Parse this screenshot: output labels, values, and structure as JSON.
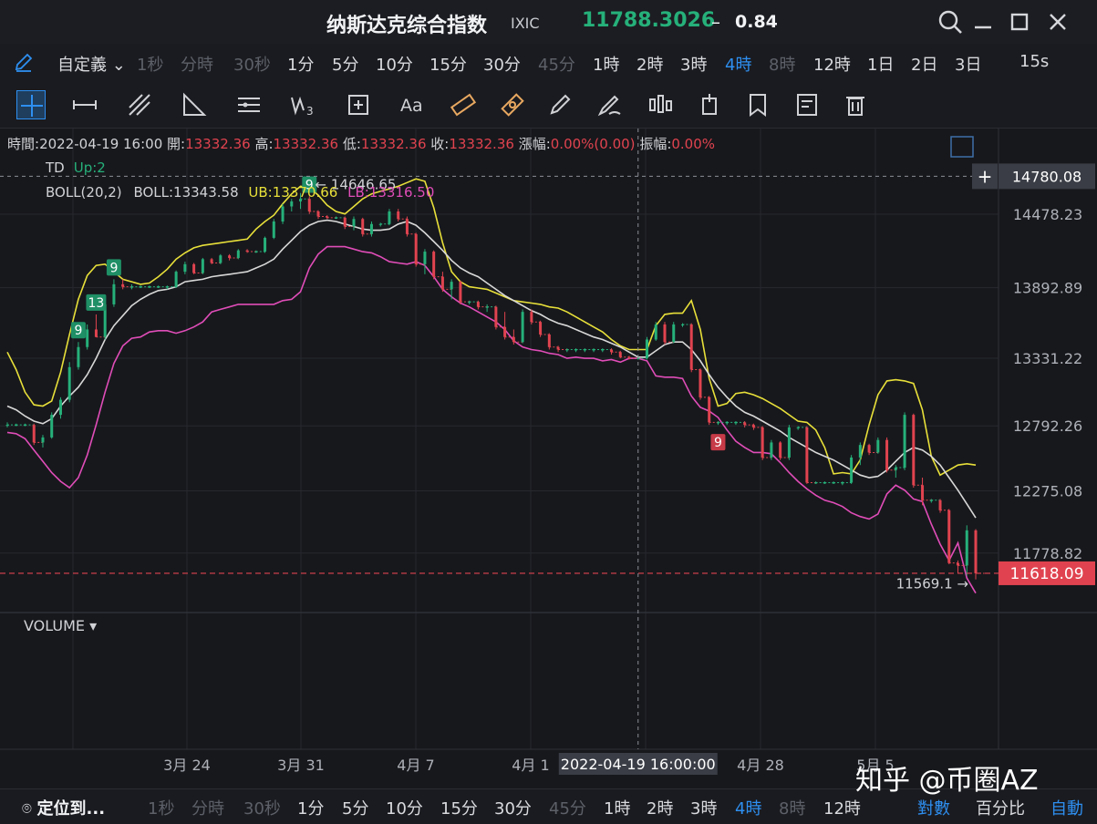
{
  "title": {
    "name": "纳斯达克综合指数",
    "code": "IXIC",
    "price": "11788.3026",
    "dash": "–",
    "change": "0.84"
  },
  "intervals": {
    "selector_label": "自定義",
    "items": [
      {
        "label": "1秒",
        "state": "dim"
      },
      {
        "label": "分時",
        "state": "dim"
      },
      {
        "label": "30秒",
        "state": "dim"
      },
      {
        "label": "1分",
        "state": "normal"
      },
      {
        "label": "5分",
        "state": "normal"
      },
      {
        "label": "10分",
        "state": "normal"
      },
      {
        "label": "15分",
        "state": "normal"
      },
      {
        "label": "30分",
        "state": "normal"
      },
      {
        "label": "45分",
        "state": "dim"
      },
      {
        "label": "1時",
        "state": "normal"
      },
      {
        "label": "2時",
        "state": "normal"
      },
      {
        "label": "3時",
        "state": "normal"
      },
      {
        "label": "4時",
        "state": "active"
      },
      {
        "label": "8時",
        "state": "dim"
      },
      {
        "label": "12時",
        "state": "normal"
      },
      {
        "label": "1日",
        "state": "normal"
      },
      {
        "label": "2日",
        "state": "normal"
      },
      {
        "label": "3日",
        "state": "normal"
      }
    ],
    "refresh": "15s"
  },
  "tools": [
    "crosshair-tool",
    "horizontal-line-tool",
    "trend-line-tool",
    "angle-tool",
    "parallel-lines-tool",
    "wave-tool",
    "measure-box-tool",
    "text-tool",
    "ruler-tool",
    "price-range-tool",
    "pen-tool",
    "brush-tool",
    "candle-tool",
    "position-tool",
    "bookmark-tool",
    "note-tool",
    "delete-tool"
  ],
  "info": {
    "time_label": "時間:",
    "time": "2022-04-19 16:00",
    "open_label": "開:",
    "open": "13332.36",
    "high_label": "高:",
    "high": "13332.36",
    "low_label": "低:",
    "low": "13332.36",
    "close_label": "收:",
    "close": "13332.36",
    "change_label": "漲幅:",
    "change": "0.00%(0.00)",
    "amp_label": "振幅:",
    "amp": "0.00%"
  },
  "indicators": {
    "td": "TD",
    "td_up": "Up:2",
    "boll": "BOLL(20,2)",
    "boll_mid": "BOLL:13343.58",
    "boll_ub": "UB:13370.66",
    "boll_lb": "LB:13316.50"
  },
  "volume_label": "VOLUME",
  "bottom": {
    "locate": "定位到...",
    "items": [
      {
        "label": "1秒",
        "state": "dim"
      },
      {
        "label": "分時",
        "state": "dim"
      },
      {
        "label": "30秒",
        "state": "dim"
      },
      {
        "label": "1分",
        "state": "normal"
      },
      {
        "label": "5分",
        "state": "normal"
      },
      {
        "label": "10分",
        "state": "normal"
      },
      {
        "label": "15分",
        "state": "normal"
      },
      {
        "label": "30分",
        "state": "normal"
      },
      {
        "label": "45分",
        "state": "dim"
      },
      {
        "label": "1時",
        "state": "normal"
      },
      {
        "label": "2時",
        "state": "normal"
      },
      {
        "label": "3時",
        "state": "normal"
      },
      {
        "label": "4時",
        "state": "active"
      },
      {
        "label": "8時",
        "state": "dim"
      },
      {
        "label": "12時",
        "state": "normal"
      }
    ],
    "log_label": "對數",
    "percent_label": "百分比",
    "auto_label": "自動"
  },
  "watermark": "知乎 @币圈AZ",
  "colors": {
    "up": "#26b07a",
    "down": "#e0434f",
    "ub": "#e8e03a",
    "lb": "#e04db8",
    "mid": "#d8d8d8",
    "accent": "#2e8ff0"
  },
  "chart_data": {
    "type": "candlestick",
    "x_ticks": [
      "3月 24",
      "3月 31",
      "4月 7",
      "4月 1",
      "4月 28",
      "5月 5"
    ],
    "y_ticks": [
      14478.23,
      13892.89,
      13331.22,
      12792.26,
      12275.08,
      11778.82
    ],
    "ylim": [
      11320,
      14950
    ],
    "crosshair": {
      "price": "14780.08",
      "date": "2022-04-19 16:00:00",
      "index": 71
    },
    "last_price": "11618.09",
    "max_marker": "14646.65",
    "min_marker": "11569.1",
    "td_marks": [
      {
        "index": 8,
        "label": "9",
        "dir": "up"
      },
      {
        "index": 12,
        "label": "9",
        "dir": "up"
      },
      {
        "index": 10,
        "label": "13",
        "dir": "up"
      },
      {
        "index": 34,
        "label": "9",
        "dir": "up"
      },
      {
        "index": 80,
        "label": "9",
        "dir": "down"
      }
    ],
    "mid": [
      12950,
      12920,
      12870,
      12830,
      12810,
      12850,
      12950,
      13030,
      13100,
      13200,
      13330,
      13480,
      13590,
      13670,
      13750,
      13800,
      13840,
      13870,
      13880,
      13900,
      13940,
      13950,
      13960,
      13980,
      13990,
      14000,
      14010,
      14020,
      14050,
      14080,
      14120,
      14200,
      14270,
      14340,
      14390,
      14420,
      14430,
      14420,
      14400,
      14380,
      14360,
      14350,
      14350,
      14360,
      14400,
      14420,
      14390,
      14330,
      14260,
      14190,
      14110,
      14050,
      14010,
      13980,
      13930,
      13880,
      13830,
      13790,
      13750,
      13710,
      13680,
      13640,
      13610,
      13590,
      13560,
      13530,
      13500,
      13480,
      13450,
      13420,
      13380,
      13340,
      13340,
      13390,
      13440,
      13460,
      13460,
      13400,
      13310,
      13200,
      13100,
      13020,
      12950,
      12900,
      12870,
      12830,
      12790,
      12750,
      12700,
      12660,
      12620,
      12580,
      12550,
      12520,
      12480,
      12440,
      12400,
      12380,
      12390,
      12440,
      12510,
      12580,
      12620,
      12600,
      12550,
      12480,
      12380,
      12280,
      12170,
      12060
    ],
    "ub": [
      13380,
      13240,
      13060,
      12960,
      12950,
      12990,
      13220,
      13520,
      13800,
      13990,
      14070,
      14080,
      14020,
      13960,
      13940,
      13920,
      13930,
      13980,
      14040,
      14120,
      14170,
      14210,
      14230,
      14240,
      14250,
      14260,
      14270,
      14280,
      14360,
      14420,
      14470,
      14560,
      14640,
      14700,
      14690,
      14630,
      14550,
      14500,
      14480,
      14540,
      14600,
      14640,
      14660,
      14680,
      14700,
      14730,
      14760,
      14740,
      14530,
      14250,
      14020,
      13940,
      13900,
      13890,
      13880,
      13850,
      13820,
      13790,
      13780,
      13770,
      13760,
      13740,
      13730,
      13700,
      13660,
      13620,
      13580,
      13540,
      13480,
      13430,
      13400,
      13400,
      13400,
      13590,
      13680,
      13690,
      13690,
      13790,
      13560,
      13170,
      12950,
      12970,
      13050,
      13060,
      13040,
      13010,
      12970,
      12930,
      12880,
      12830,
      12820,
      12760,
      12620,
      12410,
      12420,
      12410,
      12520,
      12800,
      13040,
      13150,
      13160,
      13150,
      13130,
      12920,
      12550,
      12400,
      12440,
      12480,
      12490,
      12480
    ],
    "lb": [
      12740,
      12730,
      12690,
      12600,
      12510,
      12420,
      12350,
      12300,
      12380,
      12560,
      12800,
      13060,
      13290,
      13430,
      13490,
      13500,
      13540,
      13550,
      13550,
      13530,
      13550,
      13580,
      13620,
      13700,
      13720,
      13740,
      13760,
      13760,
      13760,
      13760,
      13760,
      13790,
      13800,
      13860,
      14050,
      14160,
      14220,
      14220,
      14220,
      14200,
      14180,
      14170,
      14140,
      14100,
      14090,
      14080,
      14100,
      14070,
      13980,
      13880,
      13820,
      13770,
      13740,
      13700,
      13660,
      13620,
      13560,
      13470,
      13420,
      13400,
      13390,
      13370,
      13360,
      13330,
      13340,
      13330,
      13330,
      13310,
      13320,
      13300,
      13330,
      13330,
      13310,
      13190,
      13180,
      13180,
      13170,
      13030,
      12940,
      12910,
      12860,
      12760,
      12670,
      12620,
      12580,
      12580,
      12570,
      12500,
      12420,
      12350,
      12290,
      12240,
      12200,
      12180,
      12150,
      12100,
      12070,
      12050,
      12090,
      12250,
      12320,
      12280,
      12210,
      12190,
      12010,
      11850,
      11720,
      11860,
      11580,
      11460
    ],
    "candles": [
      [
        12800,
        12820,
        12780,
        12800
      ],
      [
        12800,
        12810,
        12790,
        12800
      ],
      [
        12800,
        12810,
        12790,
        12800
      ],
      [
        12800,
        12810,
        12640,
        12660
      ],
      [
        12660,
        12720,
        12620,
        12700
      ],
      [
        12700,
        12900,
        12690,
        12880
      ],
      [
        12880,
        13020,
        12850,
        13000
      ],
      [
        13000,
        13300,
        12980,
        13260
      ],
      [
        13260,
        13460,
        13240,
        13420
      ],
      [
        13420,
        13600,
        13400,
        13560
      ],
      [
        13560,
        13680,
        13500,
        13500
      ],
      [
        13500,
        13820,
        13480,
        13760
      ],
      [
        13760,
        13960,
        13740,
        13920
      ],
      [
        13920,
        13960,
        13880,
        13900
      ],
      [
        13900,
        13920,
        13880,
        13900
      ],
      [
        13900,
        13910,
        13890,
        13900
      ],
      [
        13900,
        13910,
        13890,
        13900
      ],
      [
        13900,
        13910,
        13890,
        13900
      ],
      [
        13900,
        13910,
        13880,
        13900
      ],
      [
        13900,
        14030,
        13890,
        14020
      ],
      [
        14020,
        14100,
        14000,
        14080
      ],
      [
        14080,
        14090,
        14000,
        14010
      ],
      [
        14010,
        14130,
        14000,
        14120
      ],
      [
        14120,
        14130,
        14080,
        14090
      ],
      [
        14090,
        14160,
        14080,
        14150
      ],
      [
        14150,
        14160,
        14110,
        14130
      ],
      [
        14130,
        14200,
        14120,
        14190
      ],
      [
        14190,
        14200,
        14170,
        14180
      ],
      [
        14180,
        14190,
        14170,
        14180
      ],
      [
        14180,
        14300,
        14170,
        14290
      ],
      [
        14290,
        14440,
        14280,
        14420
      ],
      [
        14420,
        14560,
        14400,
        14540
      ],
      [
        14540,
        14600,
        14500,
        14580
      ],
      [
        14580,
        14647,
        14520,
        14600
      ],
      [
        14600,
        14620,
        14480,
        14500
      ],
      [
        14500,
        14510,
        14440,
        14460
      ],
      [
        14460,
        14470,
        14440,
        14450
      ],
      [
        14450,
        14460,
        14440,
        14450
      ],
      [
        14450,
        14460,
        14360,
        14380
      ],
      [
        14380,
        14460,
        14350,
        14440
      ],
      [
        14440,
        14450,
        14300,
        14320
      ],
      [
        14320,
        14420,
        14300,
        14400
      ],
      [
        14400,
        14410,
        14380,
        14400
      ],
      [
        14400,
        14520,
        14390,
        14500
      ],
      [
        14500,
        14520,
        14420,
        14440
      ],
      [
        14440,
        14460,
        14300,
        14320
      ],
      [
        14320,
        14330,
        14060,
        14080
      ],
      [
        14080,
        14200,
        14000,
        14180
      ],
      [
        14180,
        14190,
        13960,
        13980
      ],
      [
        13980,
        14020,
        13860,
        13880
      ],
      [
        13880,
        13960,
        13800,
        13940
      ],
      [
        13940,
        13950,
        13760,
        13780
      ],
      [
        13780,
        13790,
        13760,
        13780
      ],
      [
        13780,
        13790,
        13720,
        13740
      ],
      [
        13740,
        13760,
        13700,
        13740
      ],
      [
        13740,
        13750,
        13560,
        13580
      ],
      [
        13580,
        13700,
        13480,
        13500
      ],
      [
        13500,
        13560,
        13440,
        13460
      ],
      [
        13460,
        13720,
        13450,
        13700
      ],
      [
        13700,
        13720,
        13600,
        13620
      ],
      [
        13620,
        13630,
        13500,
        13520
      ],
      [
        13520,
        13530,
        13400,
        13420
      ],
      [
        13420,
        13430,
        13380,
        13400
      ],
      [
        13400,
        13410,
        13380,
        13400
      ],
      [
        13400,
        13410,
        13380,
        13400
      ],
      [
        13400,
        13410,
        13380,
        13400
      ],
      [
        13400,
        13410,
        13380,
        13400
      ],
      [
        13400,
        13410,
        13380,
        13400
      ],
      [
        13400,
        13410,
        13360,
        13380
      ],
      [
        13380,
        13390,
        13330,
        13340
      ],
      [
        13340,
        13350,
        13320,
        13332
      ],
      [
        13332,
        13340,
        13320,
        13332
      ],
      [
        13332,
        13500,
        13320,
        13480
      ],
      [
        13480,
        13620,
        13470,
        13600
      ],
      [
        13600,
        13620,
        13440,
        13460
      ],
      [
        13460,
        13620,
        13450,
        13600
      ],
      [
        13600,
        13610,
        13580,
        13600
      ],
      [
        13600,
        13610,
        13220,
        13240
      ],
      [
        13240,
        13250,
        13000,
        13020
      ],
      [
        13020,
        13030,
        12800,
        12820
      ],
      [
        12820,
        12830,
        12800,
        12820
      ],
      [
        12820,
        12830,
        12800,
        12820
      ],
      [
        12820,
        12830,
        12800,
        12820
      ],
      [
        12820,
        12830,
        12780,
        12800
      ],
      [
        12800,
        12810,
        12760,
        12780
      ],
      [
        12780,
        12790,
        12520,
        12540
      ],
      [
        12540,
        12680,
        12520,
        12660
      ],
      [
        12660,
        12670,
        12520,
        12540
      ],
      [
        12540,
        12800,
        12520,
        12780
      ],
      [
        12780,
        12790,
        12760,
        12780
      ],
      [
        12780,
        12790,
        12330,
        12340
      ],
      [
        12340,
        12350,
        12330,
        12340
      ],
      [
        12340,
        12350,
        12330,
        12340
      ],
      [
        12340,
        12350,
        12330,
        12340
      ],
      [
        12340,
        12350,
        12320,
        12340
      ],
      [
        12340,
        12560,
        12330,
        12540
      ],
      [
        12540,
        12660,
        12480,
        12640
      ],
      [
        12640,
        12650,
        12560,
        12580
      ],
      [
        12580,
        12700,
        12570,
        12680
      ],
      [
        12680,
        12700,
        12420,
        12440
      ],
      [
        12440,
        12480,
        12380,
        12460
      ],
      [
        12460,
        12900,
        12440,
        12880
      ],
      [
        12880,
        12890,
        12300,
        12320
      ],
      [
        12320,
        12380,
        12160,
        12200
      ],
      [
        12200,
        12210,
        12180,
        12200
      ],
      [
        12200,
        12210,
        12100,
        12120
      ],
      [
        12120,
        12130,
        11690,
        11700
      ],
      [
        11700,
        11720,
        11620,
        11680
      ],
      [
        11680,
        12000,
        11600,
        11960
      ],
      [
        11960,
        11970,
        11570,
        11618
      ]
    ]
  }
}
